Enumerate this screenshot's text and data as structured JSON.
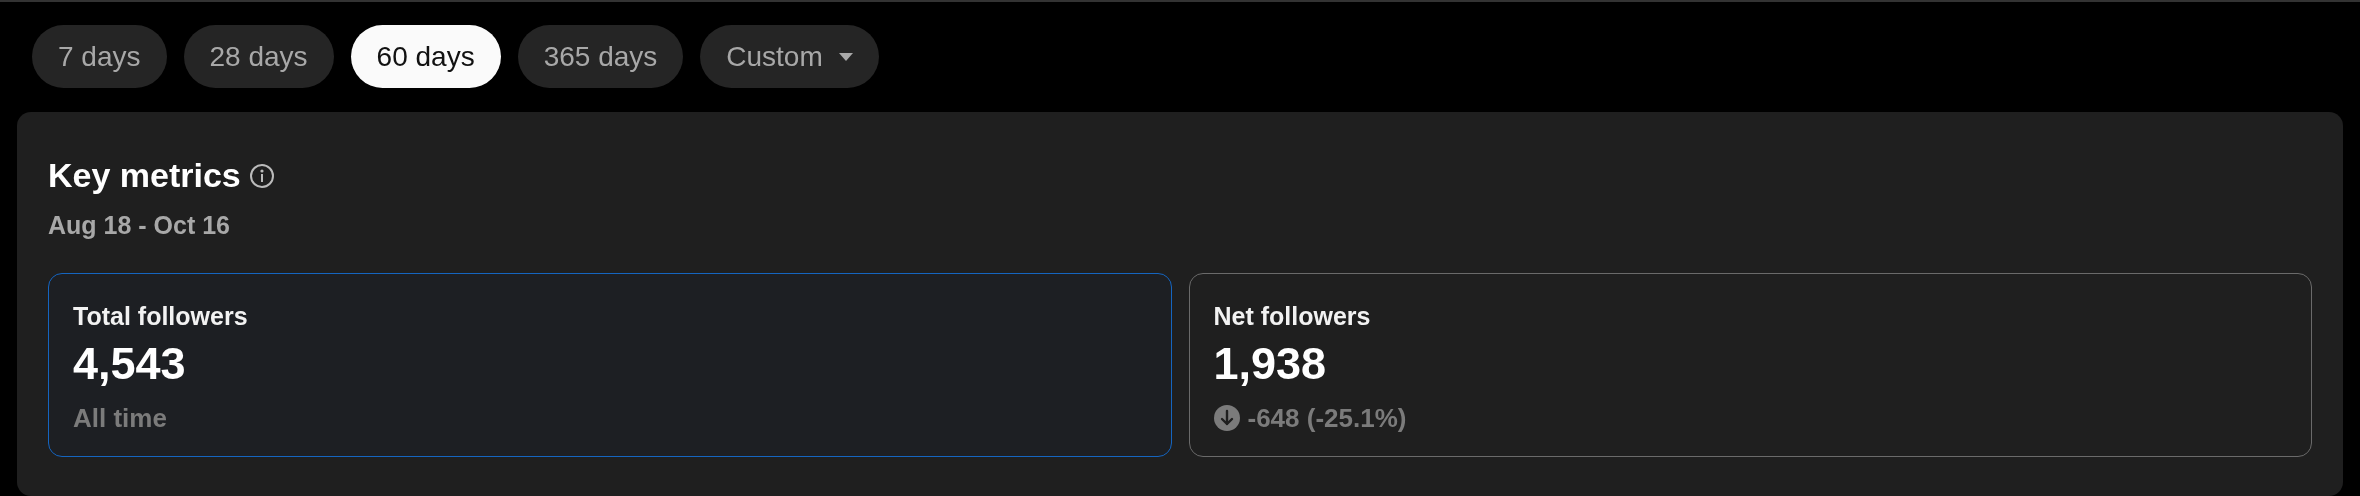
{
  "ranges": [
    {
      "label": "7 days",
      "selected": false
    },
    {
      "label": "28 days",
      "selected": false
    },
    {
      "label": "60 days",
      "selected": true
    },
    {
      "label": "365 days",
      "selected": false
    },
    {
      "label": "Custom",
      "selected": false,
      "kind": "dropdown"
    }
  ],
  "panel": {
    "title": "Key metrics",
    "subtitle": "Aug 18 - Oct 16",
    "cards": [
      {
        "label": "Total followers",
        "value": "4,543",
        "note": "All time",
        "selected": true
      },
      {
        "label": "Net followers",
        "value": "1,938",
        "note": "-648 (-25.1%)",
        "falling": true,
        "selected": false
      }
    ]
  }
}
